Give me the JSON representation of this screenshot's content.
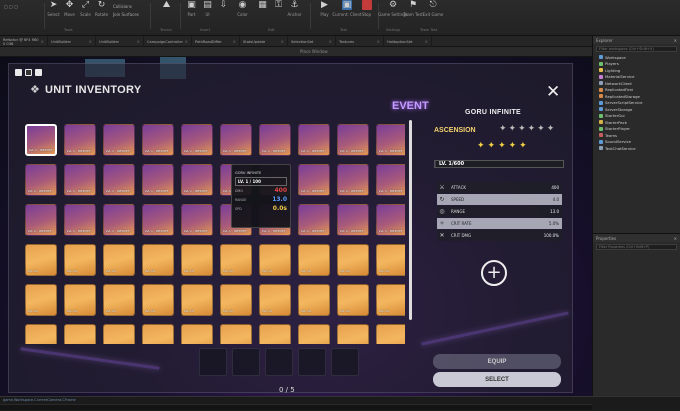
{
  "ribbon": {
    "buttons": [
      {
        "label": "Select",
        "icon": "cursor-icon"
      },
      {
        "label": "Move",
        "icon": "move-icon"
      },
      {
        "label": "Scale",
        "icon": "scale-icon"
      },
      {
        "label": "Rotate",
        "icon": "rotate-icon"
      }
    ],
    "options": [
      "Collisions",
      "Join Surfaces"
    ],
    "right_buttons": [
      {
        "label": "Part",
        "icon": "part-icon"
      },
      {
        "label": "UI",
        "icon": "ui-icon"
      },
      {
        "label": "Color",
        "icon": "color-icon"
      },
      {
        "label": "Anchor",
        "icon": "anchor-icon"
      }
    ],
    "run_buttons": [
      {
        "label": "Play",
        "icon": "play-icon"
      },
      {
        "label": "Current: Client",
        "icon": "client-icon"
      },
      {
        "label": "Stop",
        "icon": "stop-icon"
      }
    ],
    "misc_buttons": [
      {
        "label": "Game Settings",
        "icon": "settings-icon"
      },
      {
        "label": "Team Test",
        "icon": "team-test-icon"
      },
      {
        "label": "Exit Game",
        "icon": "exit-icon"
      }
    ],
    "group_labels": [
      "Tools",
      "Terrain",
      "Insert",
      "Edit",
      "Test",
      "Settings",
      "Team Test"
    ]
  },
  "tabs": [
    "Refactor @ 6F4 fl60 0 036",
    "UnitBuilder",
    "UnitBuilder",
    "CampaignController",
    "PathRoadDiffer",
    "StatsUpdate",
    "SelectionSet",
    "Textures",
    "HoldoptionSet"
  ],
  "game_view_label": "Place Window",
  "inventory": {
    "title": "UNIT INVENTORY",
    "event_text": "EVENT",
    "slots_count": "0 / 5",
    "grid": [
      "p",
      "p",
      "p",
      "p",
      "p",
      "p",
      "p",
      "p",
      "p",
      "p",
      "p",
      "p",
      "p",
      "p",
      "p",
      "p",
      "p",
      "p",
      "p",
      "p",
      "p",
      "p",
      "p",
      "p",
      "p",
      "p",
      "p",
      "p",
      "p",
      "p",
      "o",
      "o",
      "o",
      "o",
      "o",
      "o",
      "o",
      "o",
      "o",
      "o",
      "o",
      "o",
      "o",
      "o",
      "o",
      "o",
      "o",
      "o",
      "o",
      "o",
      "o",
      "o",
      "o",
      "o",
      "o",
      "o",
      "o",
      "o",
      "o",
      "o"
    ],
    "level_label_purple": "LVL 1 · INFINITE",
    "level_label_orange": "LVL 19"
  },
  "tooltip": {
    "name": "GORU INFINITE",
    "level": "LV. 1 / 100",
    "rows": [
      {
        "key": "DMG",
        "value": "400",
        "color": "#e14545"
      },
      {
        "key": "RANGE",
        "value": "13.0",
        "color": "#5aa0ff"
      },
      {
        "key": "SPD",
        "value": "0.0s",
        "color": "#f2cc4a"
      }
    ]
  },
  "unit_detail": {
    "name": "GORU INFINITE",
    "ascension_label": "ASCENSION",
    "empty_stars": "✦✦✦✦✦✦",
    "full_stars": "✦✦✦✦✦",
    "level_text": "LV. 1/600",
    "level_fraction": 0.002,
    "stats": [
      {
        "icon": "sword-icon",
        "glyph": "⚔",
        "key": "ATTACK",
        "value": "400",
        "highlight": false
      },
      {
        "icon": "speed-icon",
        "glyph": "↻",
        "key": "SPEED",
        "value": "4.0",
        "highlight": true
      },
      {
        "icon": "range-icon",
        "glyph": "◎",
        "key": "RANGE",
        "value": "13.0",
        "highlight": false
      },
      {
        "icon": "crit-rate-icon",
        "glyph": "✧",
        "key": "CRIT RATE",
        "value": "5.0%",
        "highlight": true
      },
      {
        "icon": "crit-dmg-icon",
        "glyph": "✕",
        "key": "CRIT DMG",
        "value": "100.0%",
        "highlight": false
      }
    ],
    "equip_label": "EQUIP",
    "select_label": "SELECT"
  },
  "explorer": {
    "title": "Explorer",
    "filter_placeholder": "Filter workspace (Ctrl+Shift+X)",
    "items": [
      {
        "label": "Workspace",
        "color": "#5e9bd6"
      },
      {
        "label": "Players",
        "color": "#6dbf6d"
      },
      {
        "label": "Lighting",
        "color": "#e6c04a"
      },
      {
        "label": "MaterialService",
        "color": "#c77dd6"
      },
      {
        "label": "NetworkClient",
        "color": "#8aa0b8"
      },
      {
        "label": "ReplicatedFirst",
        "color": "#d68a4a"
      },
      {
        "label": "ReplicatedStorage",
        "color": "#d68a4a"
      },
      {
        "label": "ServerScriptService",
        "color": "#5e9bd6"
      },
      {
        "label": "ServerStorage",
        "color": "#5e9bd6"
      },
      {
        "label": "StarterGui",
        "color": "#6dbf6d"
      },
      {
        "label": "StarterPack",
        "color": "#d6b14a"
      },
      {
        "label": "StarterPlayer",
        "color": "#6dbf6d"
      },
      {
        "label": "Teams",
        "color": "#c75d5d"
      },
      {
        "label": "SoundService",
        "color": "#5e9bd6"
      },
      {
        "label": "TextChatService",
        "color": "#8aa0b8"
      }
    ]
  },
  "properties": {
    "title": "Properties",
    "filter_placeholder": "Filter Properties (Ctrl+Shift+P)"
  },
  "status": {
    "command_hint": "game.Workspace.CurrentCamera.CFrame"
  }
}
